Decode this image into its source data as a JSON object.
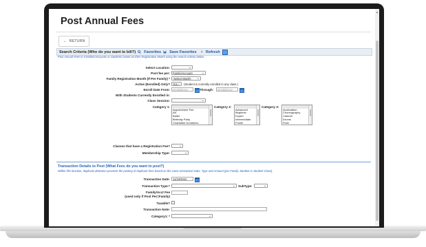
{
  "page": {
    "title": "Post Annual Fees",
    "return_label": "RETURN"
  },
  "criteria": {
    "heading": "Search Criteria (Who do you want to bill?)",
    "favorites_label": "Favorites",
    "save_favorites_label": "Save Favorites",
    "refresh_label": "Refresh",
    "subtitle": "Post Annual Fees to Families/Accounts or Students based on their Registration Month using the search criteria below",
    "select_location_label": "Select Location:",
    "select_location_value": "",
    "post_fee_per_label": "Post fee per:",
    "post_fee_per_value": "Family/Account",
    "family_reg_month_label": "Family Registration Month (If Per Family) *",
    "family_reg_month_value": "-Select Month-",
    "active_label": "Active (Enrolled) Only?",
    "active_value": "Yes",
    "active_note": "(Student is currently enrolled in any class.)",
    "enroll_date_from_label": "Enroll Date From:",
    "enroll_date_from_placeholder": "mm/dd/yyyy",
    "through_label": "Through:",
    "through_placeholder": "mm/dd/yyyy",
    "with_students_label": "With Students Currently Enrolled in:",
    "class_session_label": "Class Session:",
    "class_session_value": "",
    "category1_label": "Category 1:",
    "category1_items": [
      "Appointment Fee",
      "Art",
      "Ballet",
      "Birthday Party",
      "Charitable Donations"
    ],
    "category2_label": "Category 2:",
    "category2_items": [
      "Advanced",
      "Beginner",
      "Expert",
      "Intermediate",
      "Pointe"
    ],
    "category3_label": "Category 3:",
    "category3_items": [
      "Acclimation",
      "Choreography",
      "Clarinet",
      "Drums",
      "Flute"
    ],
    "reg_fee_label": "Classes that have a Registration Fee?",
    "reg_fee_value": "",
    "membership_label": "Membership Type:",
    "membership_value": ""
  },
  "transaction": {
    "heading": "Transaction Details to Post (What Fees do you want to post?)",
    "subtitle": "Within this function, duplicate detection prevents the posting of duplicate fees based on the same transaction Date, Type and Amount (per Family, Student or Student-Class).",
    "date_label": "Transaction Date:",
    "date_value": "11/19/2024",
    "type_label": "Transaction Type:*",
    "type_value": "",
    "subtype_label": "SubType:",
    "subtype_value": "",
    "fee_label_line1": "Family/Acct Fee",
    "fee_label_line2": "(used only if Post Per=Family)",
    "fee_value": "",
    "taxable_label": "Taxable?",
    "note_label": "Transaction Note:",
    "note_value": "",
    "category1_label": "Category1: *",
    "category1_value": ""
  },
  "colors": {
    "accent": "#2a62b5",
    "header_bg": "#e9eef5"
  }
}
